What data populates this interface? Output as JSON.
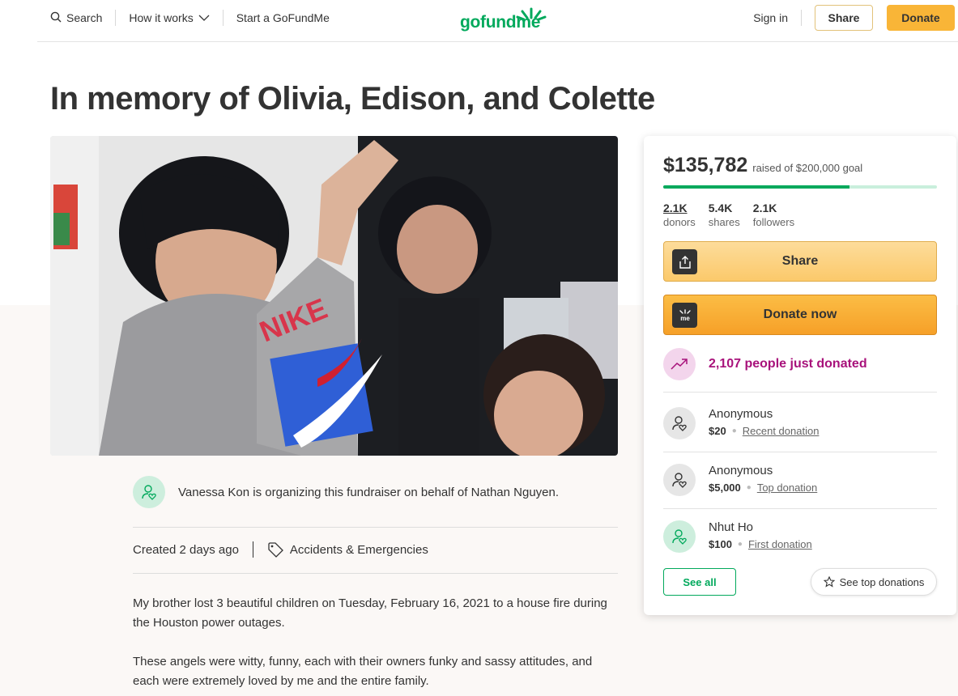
{
  "header": {
    "search_label": "Search",
    "how_it_works_label": "How it works",
    "start_label": "Start a GoFundMe",
    "logo_text": "gofundme",
    "signin_label": "Sign in",
    "share_label": "Share",
    "donate_label": "Donate"
  },
  "campaign": {
    "title": "In memory of Olivia, Edison, and Colette",
    "organizer_text": "Vanessa Kon is organizing this fundraiser on behalf of Nathan Nguyen.",
    "created": "Created 2 days ago",
    "category": "Accidents & Emergencies",
    "story": [
      "My brother lost 3 beautiful children on Tuesday, February 16, 2021 to a house fire during the Houston power outages.",
      "These angels were witty, funny, each with their owners funky and sassy attitudes, and each were extremely loved by me and the entire family."
    ]
  },
  "sidebar": {
    "raised_amount": "$135,782",
    "raised_goal": "raised of $200,000 goal",
    "progress_fraction": 0.679,
    "stats": [
      {
        "value": "2.1K",
        "label": "donors"
      },
      {
        "value": "5.4K",
        "label": "shares"
      },
      {
        "value": "2.1K",
        "label": "followers"
      }
    ],
    "share_label": "Share",
    "donate_now_label": "Donate now",
    "donate_icon_text": "me",
    "just_donated": "2,107 people just donated",
    "donations": [
      {
        "name": "Anonymous",
        "amount": "$20",
        "tag": "Recent donation"
      },
      {
        "name": "Anonymous",
        "amount": "$5,000",
        "tag": "Top donation"
      },
      {
        "name": "Nhut Ho",
        "amount": "$100",
        "tag": "First donation"
      }
    ],
    "see_all_label": "See all",
    "see_top_label": "See top donations"
  },
  "colors": {
    "brand_green": "#02a95c",
    "donate_orange": "#f9b537",
    "highlight_purple": "#a8127b"
  }
}
